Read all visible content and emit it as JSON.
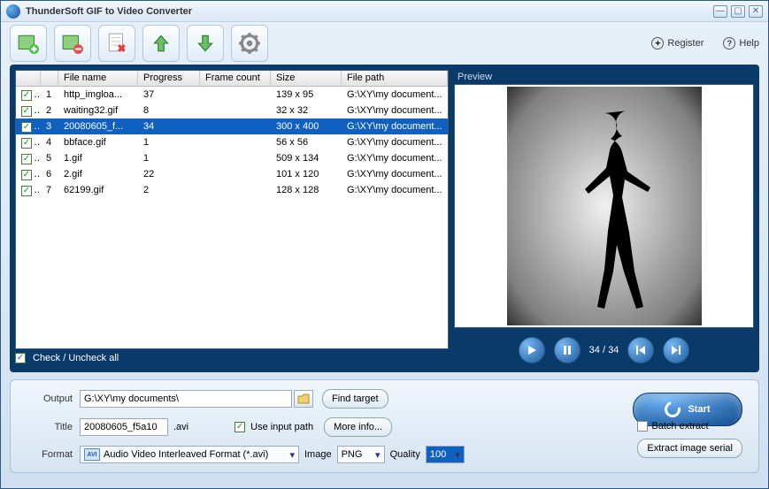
{
  "window": {
    "title": "ThunderSoft GIF to Video Converter"
  },
  "toolbar_links": {
    "register": "Register",
    "help": "Help"
  },
  "columns": {
    "filename": "File name",
    "progress": "Progress",
    "framecount": "Frame count",
    "size": "Size",
    "filepath": "File path"
  },
  "rows": [
    {
      "idx": "1",
      "fn": "http_imgloa...",
      "prog": "37",
      "fc": "",
      "sz": "139 x 95",
      "fp": "G:\\XY\\my document..."
    },
    {
      "idx": "2",
      "fn": "waiting32.gif",
      "prog": "8",
      "fc": "",
      "sz": "32 x 32",
      "fp": "G:\\XY\\my document..."
    },
    {
      "idx": "3",
      "fn": "20080605_f...",
      "prog": "34",
      "fc": "",
      "sz": "300 x 400",
      "fp": "G:\\XY\\my document..."
    },
    {
      "idx": "4",
      "fn": "bbface.gif",
      "prog": "1",
      "fc": "",
      "sz": "56 x 56",
      "fp": "G:\\XY\\my document..."
    },
    {
      "idx": "5",
      "fn": "1.gif",
      "prog": "1",
      "fc": "",
      "sz": "509 x 134",
      "fp": "G:\\XY\\my document..."
    },
    {
      "idx": "6",
      "fn": "2.gif",
      "prog": "22",
      "fc": "",
      "sz": "101 x 120",
      "fp": "G:\\XY\\my document..."
    },
    {
      "idx": "7",
      "fn": "62199.gif",
      "prog": "2",
      "fc": "",
      "sz": "128 x 128",
      "fp": "G:\\XY\\my document..."
    }
  ],
  "selected_row": 2,
  "check_all": "Check / Uncheck all",
  "preview": {
    "label": "Preview",
    "counter": "34 / 34"
  },
  "output": {
    "label": "Output",
    "value": "G:\\XY\\my documents\\",
    "find_target": "Find target"
  },
  "title_field": {
    "label": "Title",
    "value": "20080605_f5a10",
    "ext": ".avi",
    "use_input": "Use input path",
    "more_info": "More info..."
  },
  "format": {
    "label": "Format",
    "value": "Audio Video Interleaved Format (*.avi)",
    "icon_text": "AVI",
    "image_label": "Image",
    "image_value": "PNG",
    "quality_label": "Quality",
    "quality_value": "100"
  },
  "right": {
    "batch": "Batch extract",
    "extract_serial": "Extract image serial"
  },
  "start": "Start"
}
